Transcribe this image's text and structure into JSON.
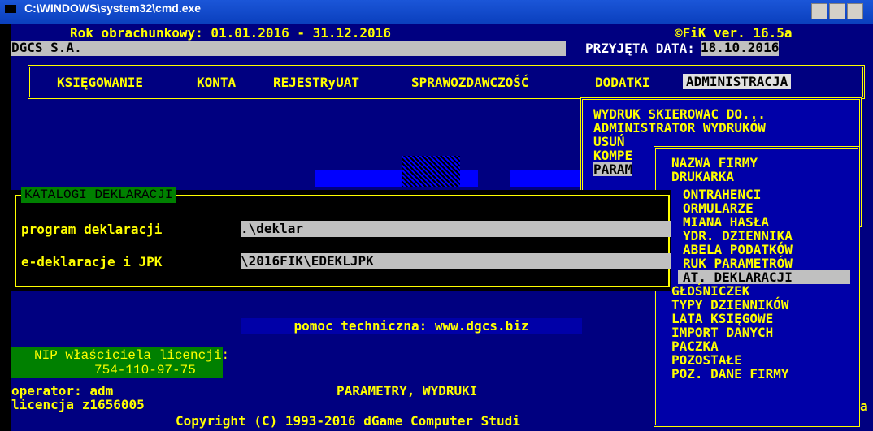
{
  "window": {
    "title": "C:\\WINDOWS\\system32\\cmd.exe"
  },
  "header": {
    "fiscal_year": "Rok obrachunkowy: 01.01.2016 - 31.12.2016",
    "version": "©FiK ver. 16.5a",
    "company": "DGCS S.A.",
    "date_label": "PRZYJĘTA DATA:",
    "date_value": "18.10.2016"
  },
  "menu": {
    "items": [
      "KSIĘGOWANIE",
      "KONTA",
      "REJESTRyUAT",
      "SPRAWOZDAWCZOŚĆ",
      "DODATKI",
      "ADMINISTRACJA"
    ],
    "active": "ADMINISTRACJA"
  },
  "admin_menu": {
    "items": [
      "WYDRUK SKIEROWAC DO...",
      "ADMINISTRATOR WYDRUKÓW",
      "USUŃ",
      "KOMPE",
      "PARAM"
    ]
  },
  "param_menu": {
    "items": [
      "NAZWA FIRMY",
      "DRUKARKA",
      "ONTRAHENCI",
      "ORMULARZE",
      "MIANA HASŁA",
      "YDR. DZIENNIKA",
      "ABELA PODATKÓW",
      "RUK PARAMETRÓW",
      "AT. DEKLARACJI",
      "GŁOŚNICZEK",
      "TYPY DZIENNIKÓW",
      "LATA KSIĘGOWE",
      "IMPORT DANYCH",
      "PACZKA",
      "POZOSTAŁE",
      "POZ. DANE FIRMY"
    ],
    "selected": "AT. DEKLARACJI"
  },
  "dialog": {
    "title": "KATALOGI DEKLARACJI",
    "fields": [
      {
        "label": "program deklaracji",
        "value": ".\\deklar"
      },
      {
        "label": "e-deklaracje i JPK",
        "value": "\\2016FIK\\EDEKLJPK"
      }
    ]
  },
  "help": "pomoc techniczna: www.dgcs.biz",
  "license_box": {
    "label": "NIP właściciela licencji:",
    "nip": "754-110-97-75"
  },
  "status": {
    "operator": "operator: adm",
    "license": "licencja z1656005",
    "context": "PARAMETRY, WYDRUKI",
    "copyright": "Copyright (C) 1993-2016 dGame Computer Studi",
    "trailing": "a"
  }
}
